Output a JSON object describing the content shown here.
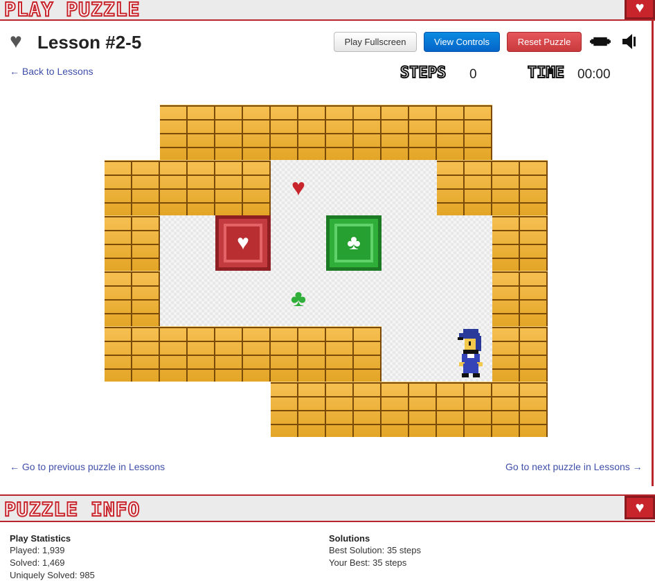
{
  "top_header": {
    "title": "PLAY PUZZLE",
    "icon": "heart-icon"
  },
  "puzzle": {
    "title": "Lesson #2-5",
    "back_link": "← Back to Lessons",
    "prev_link": "← Go to previous puzzle in Lessons",
    "next_link": "Go to next puzzle in Lessons →"
  },
  "buttons": {
    "play_fullscreen": "Play Fullscreen",
    "view_controls": "View Controls",
    "reset_puzzle": "Reset Puzzle"
  },
  "stats_bar": {
    "steps_label": "STEPS",
    "steps_value": "0",
    "time_label": "TIME",
    "time_value": "00:00"
  },
  "board": {
    "cols": 8,
    "rows": 6,
    "grid": [
      "XWWWWWWX",
      "WW....WW",
      "W......W",
      "W......W",
      "WWWWW..W",
      "XXXWWWWW"
    ],
    "wall_blocks": [
      [
        2,
        1
      ]
    ],
    "crates": [
      {
        "col": 2,
        "row": 2,
        "suit": "heart",
        "color": "red"
      },
      {
        "col": 4,
        "row": 2,
        "suit": "club",
        "color": "green"
      }
    ],
    "goals": [
      {
        "col": 3,
        "row": 1,
        "suit": "heart",
        "color": "#c8242c"
      },
      {
        "col": 3,
        "row": 3,
        "suit": "club",
        "color": "#2fae3a"
      }
    ],
    "player": {
      "col": 6,
      "row": 4
    }
  },
  "info_header": {
    "title": "PUZZLE INFO",
    "icon": "heart-icon"
  },
  "play_statistics": {
    "heading": "Play Statistics",
    "played": "Played: 1,939",
    "solved": "Solved: 1,469",
    "uniquely_solved": "Uniquely Solved: 985"
  },
  "solutions": {
    "heading": "Solutions",
    "best": "Best Solution: 35 steps",
    "yours": "Your Best: 35 steps"
  }
}
